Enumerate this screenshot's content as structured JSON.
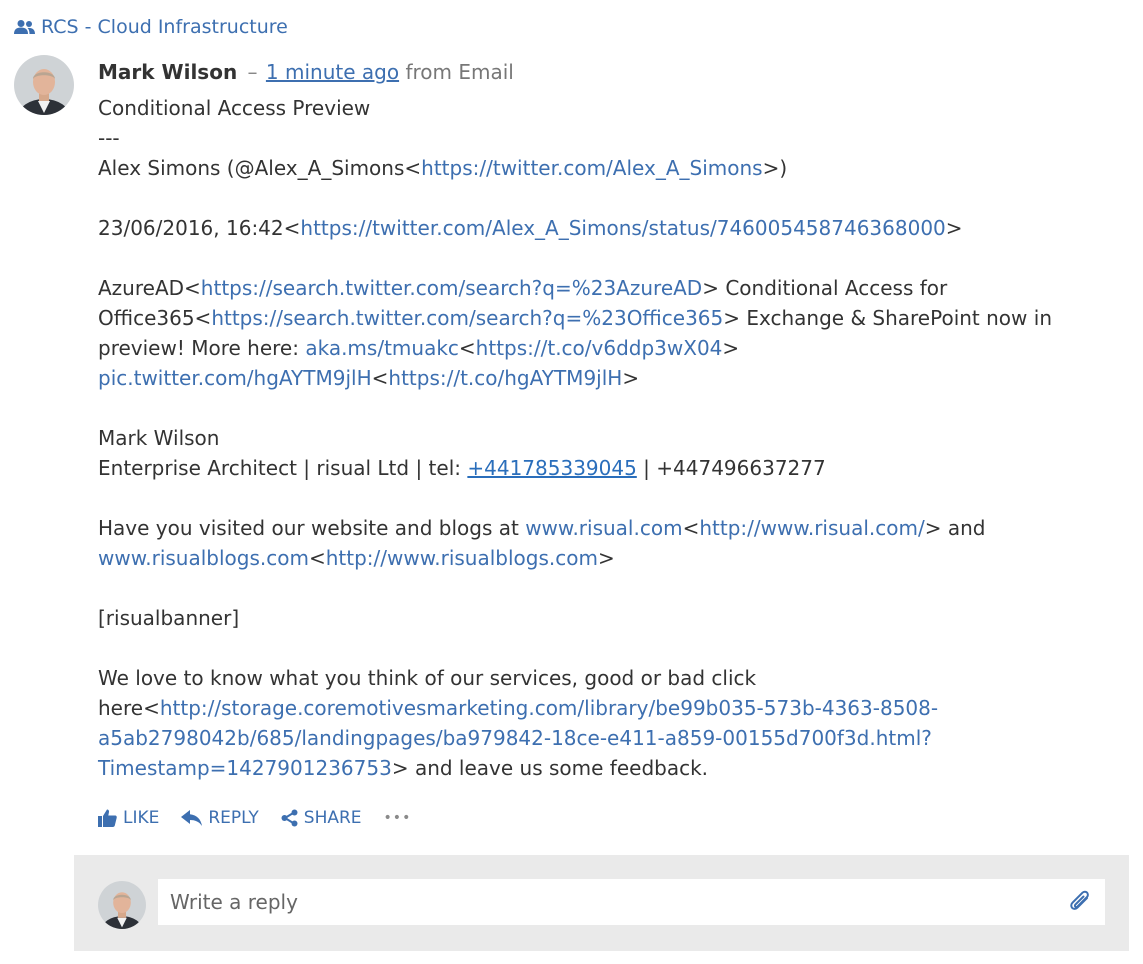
{
  "group": {
    "name": "RCS - Cloud Infrastructure",
    "icon": "people-icon"
  },
  "message": {
    "author": "Mark Wilson",
    "separator": "–",
    "time": "1 minute ago",
    "source": "from Email",
    "l01": "Conditional Access Preview",
    "l02": "---",
    "l03a": "Alex Simons (@Alex_A_Simons<",
    "l03b": "https://twitter.com/Alex_A_Simons",
    "l03c": ">)",
    "l05a": "23/06/2016, 16:42<",
    "l05b": "https://twitter.com/Alex_A_Simons/status/746005458746368000",
    "l05c": ">",
    "l07a": "AzureAD<",
    "l07b": "https://search.twitter.com/search?q=%23AzureAD",
    "l07c": "> Conditional Access for",
    "l08a": "Office365<",
    "l08b": "https://search.twitter.com/search?q=%23Office365",
    "l08c": "> Exchange & SharePoint now in",
    "l09a": "preview! More here: ",
    "l09b": "aka.ms/tmuakc",
    "l09c": "<",
    "l09d": "https://t.co/v6ddp3wX04",
    "l09e": ">",
    "l10a": "pic.twitter.com/hgAYTM9jlH",
    "l10b": "<",
    "l10c": "https://t.co/hgAYTM9jlH",
    "l10d": ">",
    "l12": "Mark Wilson",
    "l13a": "Enterprise Architect | risual Ltd | tel: ",
    "l13b": "+441785339045",
    "l13c": " | +447496637277",
    "l15a": "Have you visited our website and blogs at ",
    "l15b": "www.risual.com",
    "l15c": "<",
    "l15d": "http://www.risual.com/",
    "l15e": "> and",
    "l16a": "www.risualblogs.com",
    "l16b": "<",
    "l16c": "http://www.risualblogs.com",
    "l16d": ">",
    "l18": "[risualbanner]",
    "l20": "We love to know what you think of our services, good or bad click",
    "l21a": "here<",
    "l21b": "http://storage.coremotivesmarketing.com/library/be99b035-573b-4363-8508-",
    "l22": "a5ab2798042b/685/landingpages/ba979842-18ce-e411-a859-00155d700f3d.html?",
    "l23a": "Timestamp=1427901236753",
    "l23b": "> and leave us some feedback."
  },
  "actions": {
    "like": "LIKE",
    "reply": "REPLY",
    "share": "SHARE",
    "more": "•••"
  },
  "reply_box": {
    "placeholder": "Write a reply"
  },
  "colors": {
    "link": "#3d6fb0",
    "text": "#333333",
    "panel": "#eaeaea"
  }
}
